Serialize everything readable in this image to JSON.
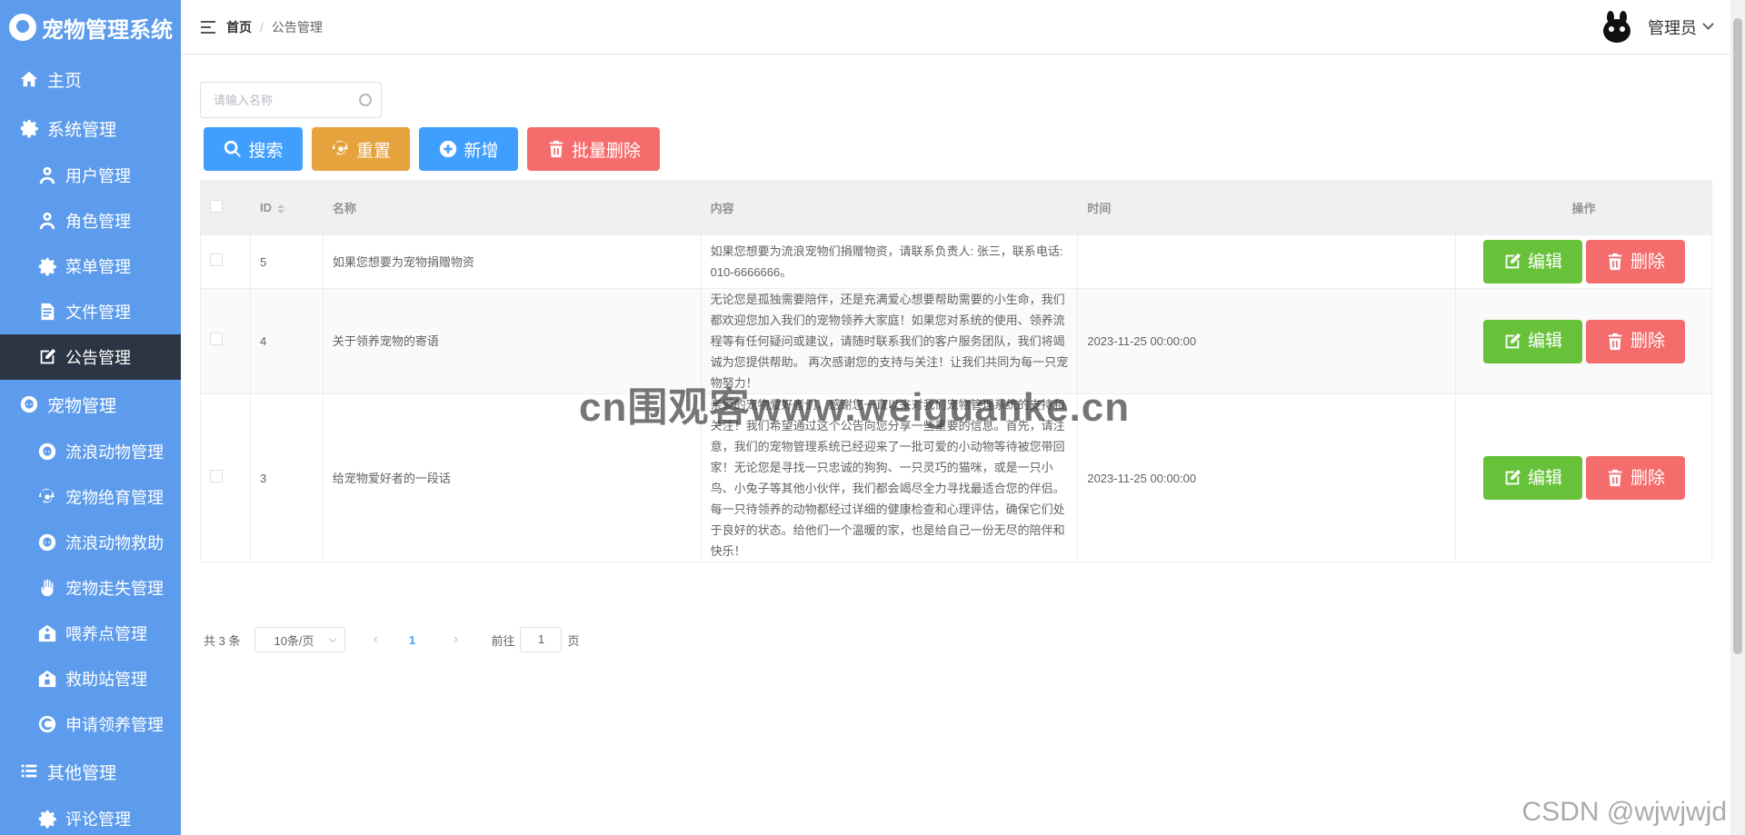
{
  "app": {
    "title": "宠物管理系统"
  },
  "sidebar": {
    "items": [
      {
        "label": "主页",
        "icon": "home-icon",
        "level": 1
      },
      {
        "label": "系统管理",
        "icon": "gear-icon",
        "level": 1
      },
      {
        "label": "用户管理",
        "icon": "user-icon",
        "level": 2
      },
      {
        "label": "角色管理",
        "icon": "user-icon",
        "level": 2
      },
      {
        "label": "菜单管理",
        "icon": "gear-icon",
        "level": 2
      },
      {
        "label": "文件管理",
        "icon": "document-icon",
        "level": 2
      },
      {
        "label": "公告管理",
        "icon": "edit-icon",
        "level": 2,
        "active": true
      },
      {
        "label": "宠物管理",
        "icon": "pet-icon",
        "level": 1
      },
      {
        "label": "流浪动物管理",
        "icon": "pet-icon",
        "level": 2
      },
      {
        "label": "宠物绝育管理",
        "icon": "refresh-icon",
        "level": 2
      },
      {
        "label": "流浪动物救助",
        "icon": "pet-icon",
        "level": 2
      },
      {
        "label": "宠物走失管理",
        "icon": "hand-icon",
        "level": 2
      },
      {
        "label": "喂养点管理",
        "icon": "house-icon",
        "level": 2
      },
      {
        "label": "救助站管理",
        "icon": "house-icon",
        "level": 2
      },
      {
        "label": "申请领养管理",
        "icon": "apply-icon",
        "level": 2
      },
      {
        "label": "其他管理",
        "icon": "list-icon",
        "level": 1
      },
      {
        "label": "评论管理",
        "icon": "gear-icon",
        "level": 2
      }
    ]
  },
  "header": {
    "breadcrumb_home": "首页",
    "breadcrumb_sep": "/",
    "breadcrumb_current": "公告管理",
    "username": "管理员"
  },
  "search": {
    "placeholder": "请输入名称"
  },
  "toolbar": {
    "search_label": "搜索",
    "reset_label": "重置",
    "add_label": "新增",
    "batch_delete_label": "批量删除"
  },
  "table": {
    "columns": {
      "id": "ID",
      "name": "名称",
      "content": "内容",
      "time": "时间",
      "ops": "操作"
    },
    "edit_label": "编辑",
    "delete_label": "删除",
    "rows": [
      {
        "id": "5",
        "name": "如果您想要为宠物捐赠物资",
        "content": "如果您想要为流浪宠物们捐赠物资，请联系负责人: 张三，联系电话: 010-6666666。",
        "time": ""
      },
      {
        "id": "4",
        "name": "关于领养宠物的寄语",
        "content": "无论您是孤独需要陪伴，还是充满爱心想要帮助需要的小生命，我们都欢迎您加入我们的宠物领养大家庭！如果您对系统的使用、领养流程等有任何疑问或建议，请随时联系我们的客户服务团队，我们将竭诚为您提供帮助。 再次感谢您的支持与关注！让我们共同为每一只宠物努力！",
        "time": "2023-11-25 00:00:00"
      },
      {
        "id": "3",
        "name": "给宠物爱好者的一段话",
        "content": "亲爱的宠物爱好者们，感谢您一直以来对我们宠物管理系统的支持和关注！我们希望通过这个公告向您分享一些重要的信息。首先，请注意，我们的宠物管理系统已经迎来了一批可爱的小动物等待被您带回家！无论您是寻找一只忠诚的狗狗、一只灵巧的猫咪，或是一只小鸟、小兔子等其他小伙伴，我们都会竭尽全力寻找最适合您的伴侣。每一只待领养的动物都经过详细的健康检查和心理评估，确保它们处于良好的状态。给他们一个温暖的家，也是给自己一份无尽的陪伴和快乐！",
        "time": "2023-11-25 00:00:00"
      }
    ]
  },
  "pagination": {
    "total": "共 3 条",
    "page_size": "10条/页",
    "current": "1",
    "goto_prefix": "前往",
    "goto_value": "1",
    "goto_suffix": "页"
  },
  "watermark": "cn围观客www.weiguanke.cn",
  "csdn_mark": "CSDN @wjwjwjd"
}
